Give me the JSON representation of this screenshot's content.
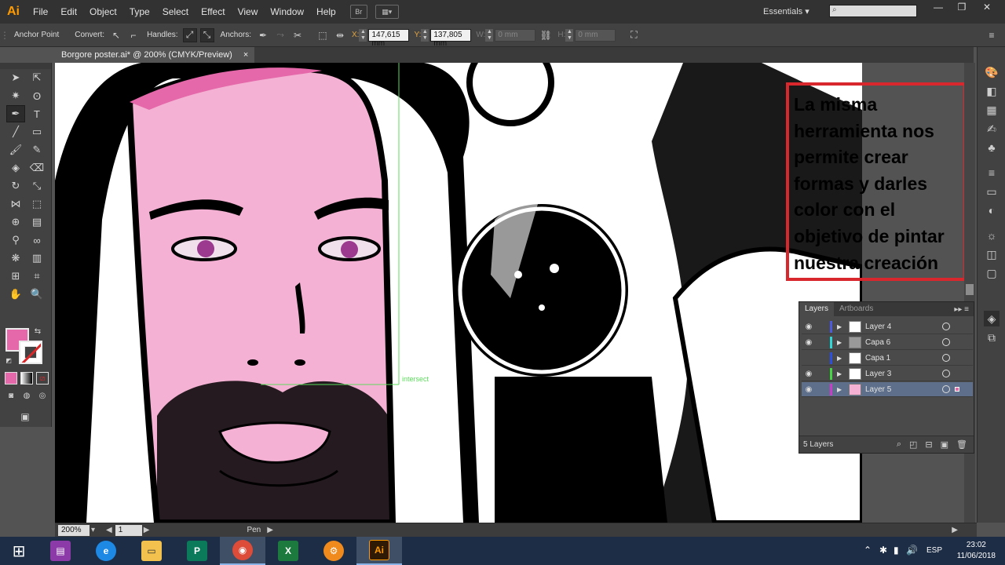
{
  "app": {
    "logo": "Ai",
    "accent": "#ff9a00"
  },
  "menu": [
    "File",
    "Edit",
    "Object",
    "Type",
    "Select",
    "Effect",
    "View",
    "Window",
    "Help"
  ],
  "menu_icons": {
    "bridge": "Br",
    "arrange": "▦▾"
  },
  "workspace": "Essentials ▾",
  "window_buttons": {
    "min": "—",
    "max": "❐",
    "close": "✕"
  },
  "control_bar": {
    "tool_label": "Anchor Point",
    "convert_label": "Convert:",
    "handles_label": "Handles:",
    "anchors_label": "Anchors:",
    "x_label": "X:",
    "x_value": "147,615 mm",
    "y_label": "Y:",
    "y_value": "137,805 mm",
    "w_label": "W:",
    "w_value": "0 mm",
    "h_label": "H:",
    "h_value": "0 mm"
  },
  "document": {
    "tab_title": "Borgore poster.ai* @ 200% (CMYK/Preview)",
    "close": "×"
  },
  "canvas": {
    "smart_guide": "intersect"
  },
  "callout": {
    "text": "La misma herramienta nos permite crear formas y darles color con el objetivo de pintar nuestra creación",
    "border_color": "#d9272e"
  },
  "colors": {
    "fill": "#e468aa",
    "stroke_slash": "#d8282a",
    "skin": "#f5b1d3"
  },
  "layers_panel": {
    "tabs": [
      "Layers",
      "Artboards"
    ],
    "menu": "▸▸ ≡",
    "rows": [
      {
        "name": "Layer 4",
        "color": "#4c5adf",
        "visible": true
      },
      {
        "name": "Capa 6",
        "color": "#2fd6d6",
        "visible": true
      },
      {
        "name": "Capa 1",
        "color": "#2b4fe0",
        "visible": false
      },
      {
        "name": "Layer 3",
        "color": "#46d447",
        "visible": true
      },
      {
        "name": "Layer 5",
        "color": "#c83cc8",
        "visible": true
      }
    ],
    "footer": "5 Layers"
  },
  "status": {
    "zoom": "200%",
    "artboard": "1",
    "tool": "Pen"
  },
  "taskbar": {
    "language": "ESP",
    "time": "23:02",
    "date": "11/06/2018",
    "apps": [
      {
        "name": "winrar",
        "label": "▤",
        "color": "#8b3aa8"
      },
      {
        "name": "internet-explorer",
        "label": "e",
        "color": "#1e88e5"
      },
      {
        "name": "file-explorer",
        "label": "▭",
        "color": "#f2c14e"
      },
      {
        "name": "publisher",
        "label": "P",
        "color": "#0b7a5a"
      },
      {
        "name": "chrome",
        "label": "◉",
        "color": "#dd4b39"
      },
      {
        "name": "excel",
        "label": "X",
        "color": "#1d7a3f"
      },
      {
        "name": "vlc",
        "label": "⚙",
        "color": "#f08a1c"
      },
      {
        "name": "illustrator",
        "label": "Ai",
        "color": "#2e1a05"
      }
    ]
  }
}
